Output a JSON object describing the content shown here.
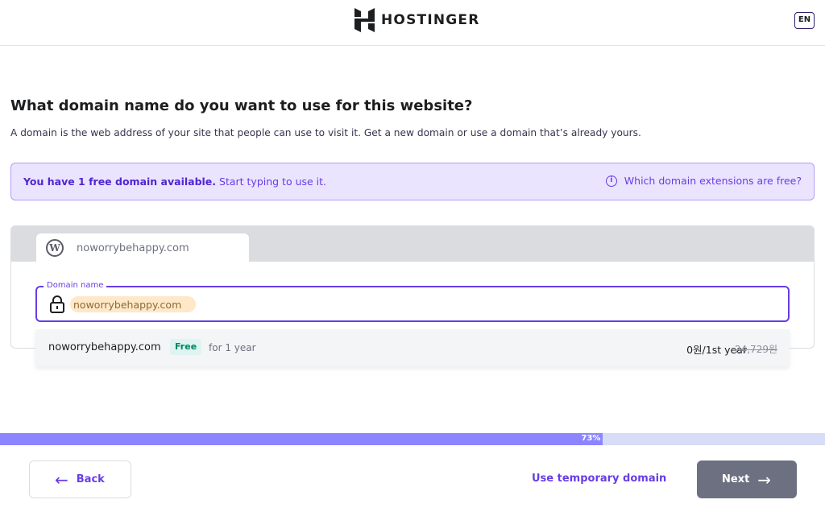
{
  "header": {
    "brand": "HOSTINGER",
    "language": "EN"
  },
  "page": {
    "title": "What domain name do you want to use for this website?",
    "subtitle": "A domain is the web address of your site that people can use to visit it. Get a new domain or use a domain that’s already yours."
  },
  "banner": {
    "bold_text": "You have 1 free domain available.",
    "text": "Start typing to use it.",
    "link": "Which domain extensions are free?"
  },
  "site_tab": {
    "name": "noworrybehappy.com"
  },
  "domain_field": {
    "label": "Domain name",
    "value": "noworrybehappy.com"
  },
  "suggestion": {
    "domain": "noworrybehappy.com",
    "badge": "Free",
    "term": "for 1 year",
    "price": "0원/1st year",
    "old_price": "24,729원"
  },
  "progress": {
    "percent": 73,
    "label": "73%"
  },
  "footer": {
    "back_label": "Back",
    "temp_domain_label": "Use temporary domain",
    "next_label": "Next"
  },
  "colors": {
    "accent": "#673de6",
    "progress_fill": "#8c85ff",
    "progress_track": "#d7dcf7",
    "next_button": "#6d7081"
  }
}
